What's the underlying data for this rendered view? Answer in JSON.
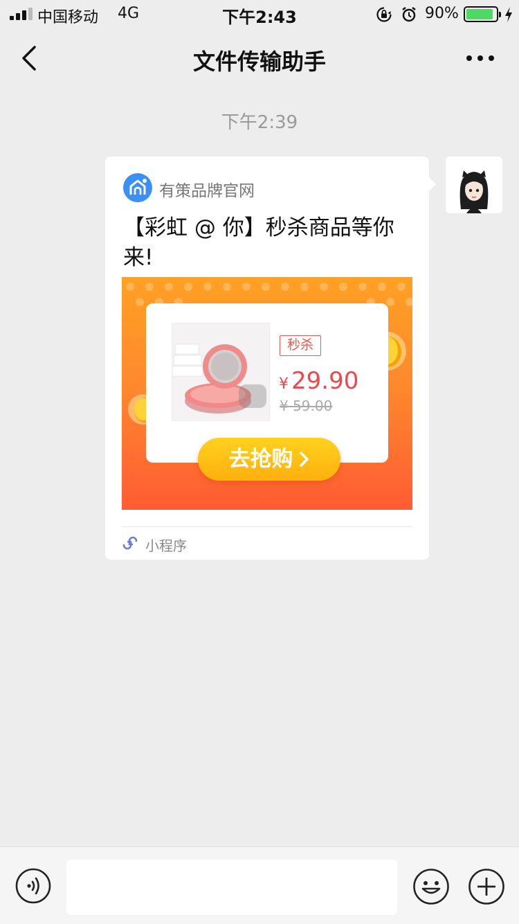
{
  "status_bar": {
    "carrier": "中国移动",
    "network": "4G",
    "time": "下午2:43",
    "battery": "90%",
    "battery_level": 0.9,
    "battery_color": "#4cd964",
    "icons": [
      "signal-icon",
      "orientation-lock-icon",
      "alarm-icon",
      "battery-icon",
      "charging-icon"
    ]
  },
  "nav": {
    "title": "文件传输助手",
    "icons": [
      "back-chevron-icon",
      "more-dots-icon"
    ]
  },
  "chat": {
    "timestamp": "下午2:39",
    "message": {
      "source_name": "有策品牌官网",
      "title": "【彩虹 @ 你】秒杀商品等你来!",
      "banner": {
        "tag": "秒杀",
        "currency": "¥",
        "price": "29.90",
        "original_price": "¥ 59.00",
        "button_label": "去抢购",
        "accent": "#f0474a"
      },
      "footer_label": "小程序"
    }
  },
  "input_bar": {
    "placeholder": "",
    "icons": [
      "voice-icon",
      "emoji-icon",
      "plus-icon"
    ]
  }
}
